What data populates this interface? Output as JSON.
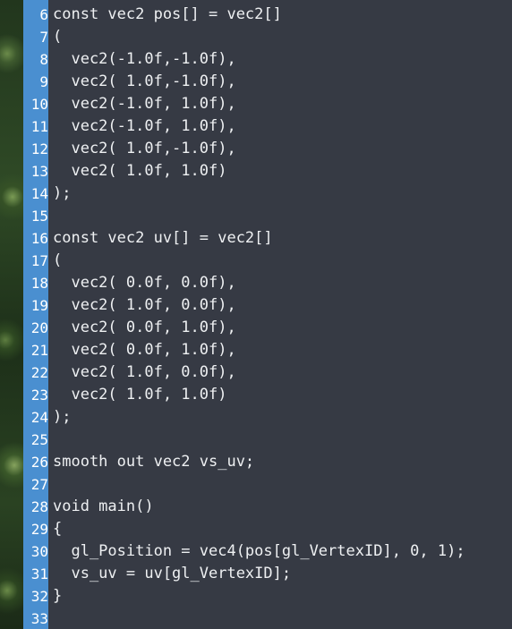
{
  "editor": {
    "lines": [
      {
        "num": "6",
        "text": "const vec2 pos[] = vec2[]"
      },
      {
        "num": "7",
        "text": "("
      },
      {
        "num": "8",
        "text": "  vec2(-1.0f,-1.0f),"
      },
      {
        "num": "9",
        "text": "  vec2( 1.0f,-1.0f),"
      },
      {
        "num": "10",
        "text": "  vec2(-1.0f, 1.0f),"
      },
      {
        "num": "11",
        "text": "  vec2(-1.0f, 1.0f),"
      },
      {
        "num": "12",
        "text": "  vec2( 1.0f,-1.0f),"
      },
      {
        "num": "13",
        "text": "  vec2( 1.0f, 1.0f)"
      },
      {
        "num": "14",
        "text": ");"
      },
      {
        "num": "15",
        "text": ""
      },
      {
        "num": "16",
        "text": "const vec2 uv[] = vec2[]"
      },
      {
        "num": "17",
        "text": "("
      },
      {
        "num": "18",
        "text": "  vec2( 0.0f, 0.0f),"
      },
      {
        "num": "19",
        "text": "  vec2( 1.0f, 0.0f),"
      },
      {
        "num": "20",
        "text": "  vec2( 0.0f, 1.0f),"
      },
      {
        "num": "21",
        "text": "  vec2( 0.0f, 1.0f),"
      },
      {
        "num": "22",
        "text": "  vec2( 1.0f, 0.0f),"
      },
      {
        "num": "23",
        "text": "  vec2( 1.0f, 1.0f)"
      },
      {
        "num": "24",
        "text": ");"
      },
      {
        "num": "25",
        "text": ""
      },
      {
        "num": "26",
        "text": "smooth out vec2 vs_uv;"
      },
      {
        "num": "27",
        "text": ""
      },
      {
        "num": "28",
        "text": "void main()"
      },
      {
        "num": "29",
        "text": "{"
      },
      {
        "num": "30",
        "text": "  gl_Position = vec4(pos[gl_VertexID], 0, 1);"
      },
      {
        "num": "31",
        "text": "  vs_uv = uv[gl_VertexID];"
      },
      {
        "num": "32",
        "text": "}"
      },
      {
        "num": "33",
        "text": ""
      }
    ]
  },
  "colors": {
    "gutter": "#4a8fd0",
    "background": "#363a44",
    "text": "#eef0f2"
  }
}
